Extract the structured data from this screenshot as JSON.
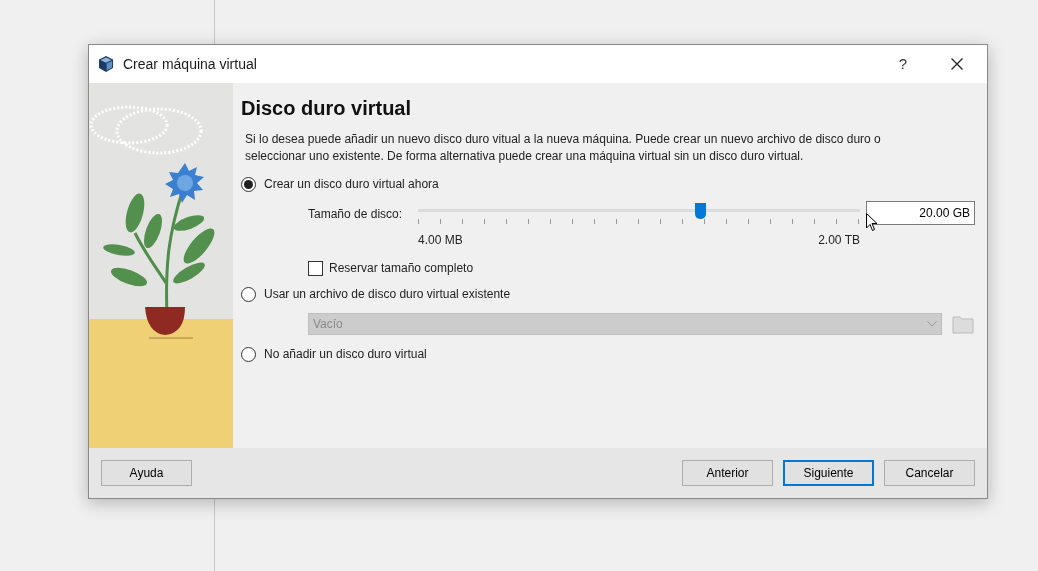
{
  "window": {
    "title": "Crear máquina virtual",
    "help_glyph": "?"
  },
  "heading": "Disco duro virtual",
  "description": "Si lo desea puede añadir un nuevo disco duro vitual a la nueva máquina. Puede crear un nuevo archivo de disco duro o seleccionar uno existente. De forma alternativa puede crear una máquina virtual sin un disco duro virtual.",
  "options": [
    {
      "kind": "create",
      "label": "Crear un disco duro virtual ahora",
      "selected": true
    },
    {
      "kind": "existing",
      "label": "Usar un archivo de disco duro virtual existente",
      "selected": false
    },
    {
      "kind": "none",
      "label": "No añadir un disco duro virtual",
      "selected": false
    }
  ],
  "disk_size": {
    "label": "Tamaño de disco:",
    "level": 0.638,
    "value": "20.00 GB",
    "min_label": "4.00 MB",
    "max_label": "2.00 TB"
  },
  "reserve_full": {
    "label": "Reservar tamaño completo",
    "checked": false
  },
  "existing_file": {
    "value": "Vacío",
    "disabled": true
  },
  "help_button": {
    "label": "Ayuda"
  },
  "nav_buttons": [
    {
      "label": "Anterior",
      "default": false
    },
    {
      "label": "Siguiente",
      "default": true
    },
    {
      "label": "Cancelar",
      "default": false
    }
  ]
}
